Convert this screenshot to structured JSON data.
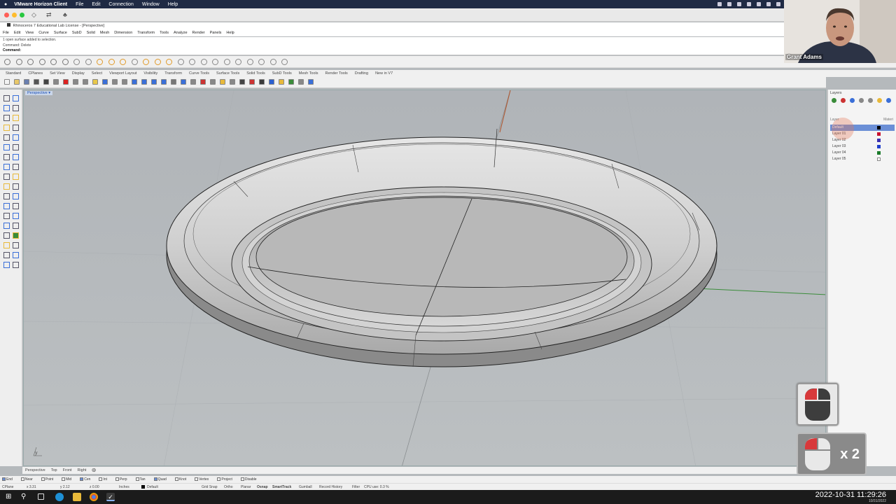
{
  "mac_menu": {
    "app_name": "VMware Horizon Client",
    "items": [
      "File",
      "Edit",
      "Connection",
      "Window",
      "Help"
    ]
  },
  "rhino": {
    "title": "Rhinoceros 7 Educational Lab License - [Perspective]",
    "menu": [
      "File",
      "Edit",
      "View",
      "Curve",
      "Surface",
      "SubD",
      "Solid",
      "Mesh",
      "Dimension",
      "Transform",
      "Tools",
      "Analyze",
      "Render",
      "Panels",
      "Help"
    ],
    "command_history": [
      "1 open surface added to selection.",
      "Command: Delete"
    ],
    "command_prompt": "Command:",
    "toolbar_tabs": [
      "Standard",
      "CPlanes",
      "Set View",
      "Display",
      "Select",
      "Viewport Layout",
      "Visibility",
      "Transform",
      "Curve Tools",
      "Surface Tools",
      "Solid Tools",
      "SubD Tools",
      "Mesh Tools",
      "Render Tools",
      "Drafting",
      "New in V7"
    ]
  },
  "viewport": {
    "active_label": "Perspective",
    "view_tabs": [
      "Perspective",
      "Top",
      "Front",
      "Right"
    ]
  },
  "osnaps": [
    "End",
    "Near",
    "Point",
    "Mid",
    "Cen",
    "Int",
    "Perp",
    "Tan",
    "Quad",
    "Knot",
    "Vertex",
    "Project",
    "Disable"
  ],
  "status": {
    "cplane": "CPlane",
    "x": "x 3.31",
    "y": "y 2.12",
    "z": "z 0.00",
    "units": "Inches",
    "layer": "Default",
    "toggles": [
      "Grid Snap",
      "Ortho",
      "Planar",
      "Osnap",
      "SmartTrack",
      "Gumball",
      "Record History",
      "Filter"
    ],
    "cpu": "CPU use: 0.3 %"
  },
  "layers_panel": {
    "title": "Layers",
    "col_layer": "Layer",
    "col_material": "Materi",
    "rows": [
      {
        "name": "Default",
        "color": "#000000"
      },
      {
        "name": "Layer 01",
        "color": "#c8102e"
      },
      {
        "name": "Layer 02",
        "color": "#3a2fb0"
      },
      {
        "name": "Layer 03",
        "color": "#1f3fcc"
      },
      {
        "name": "Layer 04",
        "color": "#1a7a2a"
      },
      {
        "name": "Layer 05",
        "color": "#ffffff"
      }
    ]
  },
  "webcam": {
    "name": "Grant Adams"
  },
  "mouse_overlay": {
    "count_label": "x 2"
  },
  "clock": {
    "time": "2022-10-31 11:29:26",
    "date": "10/31/2022"
  }
}
